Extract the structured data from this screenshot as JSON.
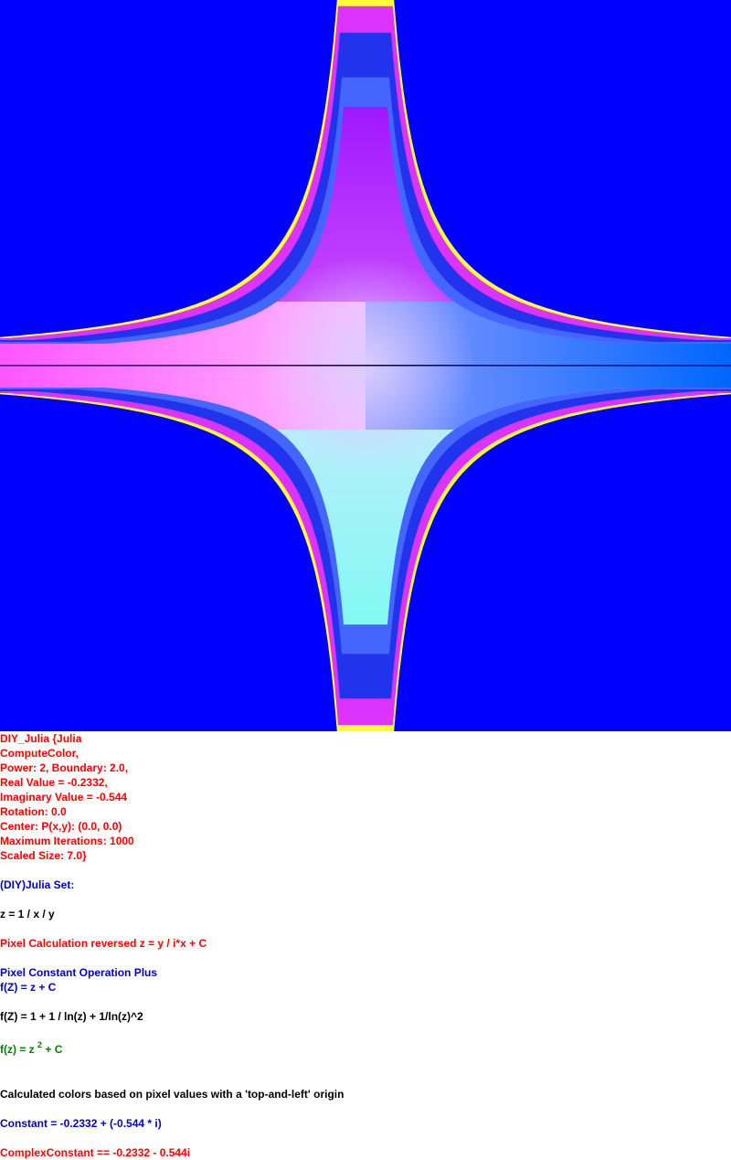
{
  "image": {
    "background_color": "#0000ff",
    "axis_line_color": "#000060",
    "gradient_colors": {
      "top": "#8800ff",
      "left": "#ff66ff",
      "center": "#ffccff",
      "right": "#0077ff",
      "bottom": "#66ffee",
      "band_magenta": "#ee22ff",
      "band_blue": "#2233ee",
      "band_cyan": "#00eeff",
      "edge_yellow": "#ffff33"
    }
  },
  "caption": {
    "params": [
      "DIY_Julia {Julia",
      "ComputeColor,",
      "Power: 2, Boundary: 2.0,",
      "Real Value = -0.2332,",
      "Imaginary Value = -0.544",
      "Rotation: 0.0",
      "Center: P(x,y): (0.0, 0.0)",
      "Maximum Iterations: 1000",
      "Scaled Size: 7.0}"
    ],
    "set_title": "(DIY)Julia Set:",
    "z_formula": "z = 1 / x / y",
    "pixel_calc": "Pixel Calculation reversed z = y / i*x + C",
    "pixel_constant_op": "Pixel Constant Operation Plus",
    "fz_plus": "f(Z) = z + C",
    "fz_ln": "f(Z) = 1 + 1 / ln(z) + 1/ln(z)^2",
    "fz_power_pre": "f(z) = z ",
    "fz_power_exp": "2",
    "fz_power_post": " + C",
    "origin_note": "Calculated colors based on pixel values with a 'top-and-left' origin",
    "constant": "Constant = -0.2332 + (-0.544 * i)",
    "complex_constant": "ComplexConstant == -0.2332 - 0.544i"
  }
}
